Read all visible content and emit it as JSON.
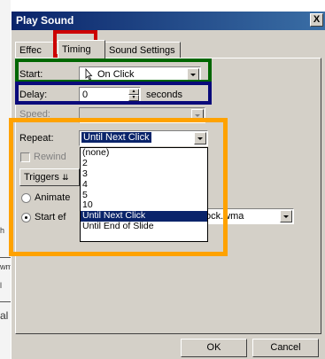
{
  "dialog": {
    "title": "Play Sound",
    "close_glyph": "X"
  },
  "tabs": [
    {
      "label": "Effect",
      "shown": "Effec"
    },
    {
      "label": "Timing"
    },
    {
      "label": "Sound Settings"
    }
  ],
  "timing": {
    "start_label": "Start:",
    "start_value": "On Click",
    "delay_label": "Delay:",
    "delay_value": "0",
    "delay_unit": "seconds",
    "speed_label": "Speed:",
    "repeat_label": "Repeat:",
    "repeat_value": "Until Next Click",
    "rewind_label": "Rewind",
    "triggers_label": "Triggers",
    "animate_label": "Animate",
    "start_effect_label": "Start ef",
    "start_effect_file": "ock.wma"
  },
  "repeat_options": [
    "(none)",
    "2",
    "3",
    "4",
    "5",
    "10",
    "Until Next Click",
    "Until End of Slide"
  ],
  "buttons": {
    "ok": "OK",
    "cancel": "Cancel"
  },
  "background_fragments": {
    "h": "h",
    "wm": "wm",
    "l": "l",
    "al": "al"
  },
  "colors": {
    "highlight_red": "#cc0000",
    "highlight_green": "#006600",
    "highlight_navy": "#0a0a7a",
    "highlight_orange": "#ffa200",
    "selection": "#0a246a"
  },
  "icons": {
    "start_icon": "mouse-click-icon"
  }
}
